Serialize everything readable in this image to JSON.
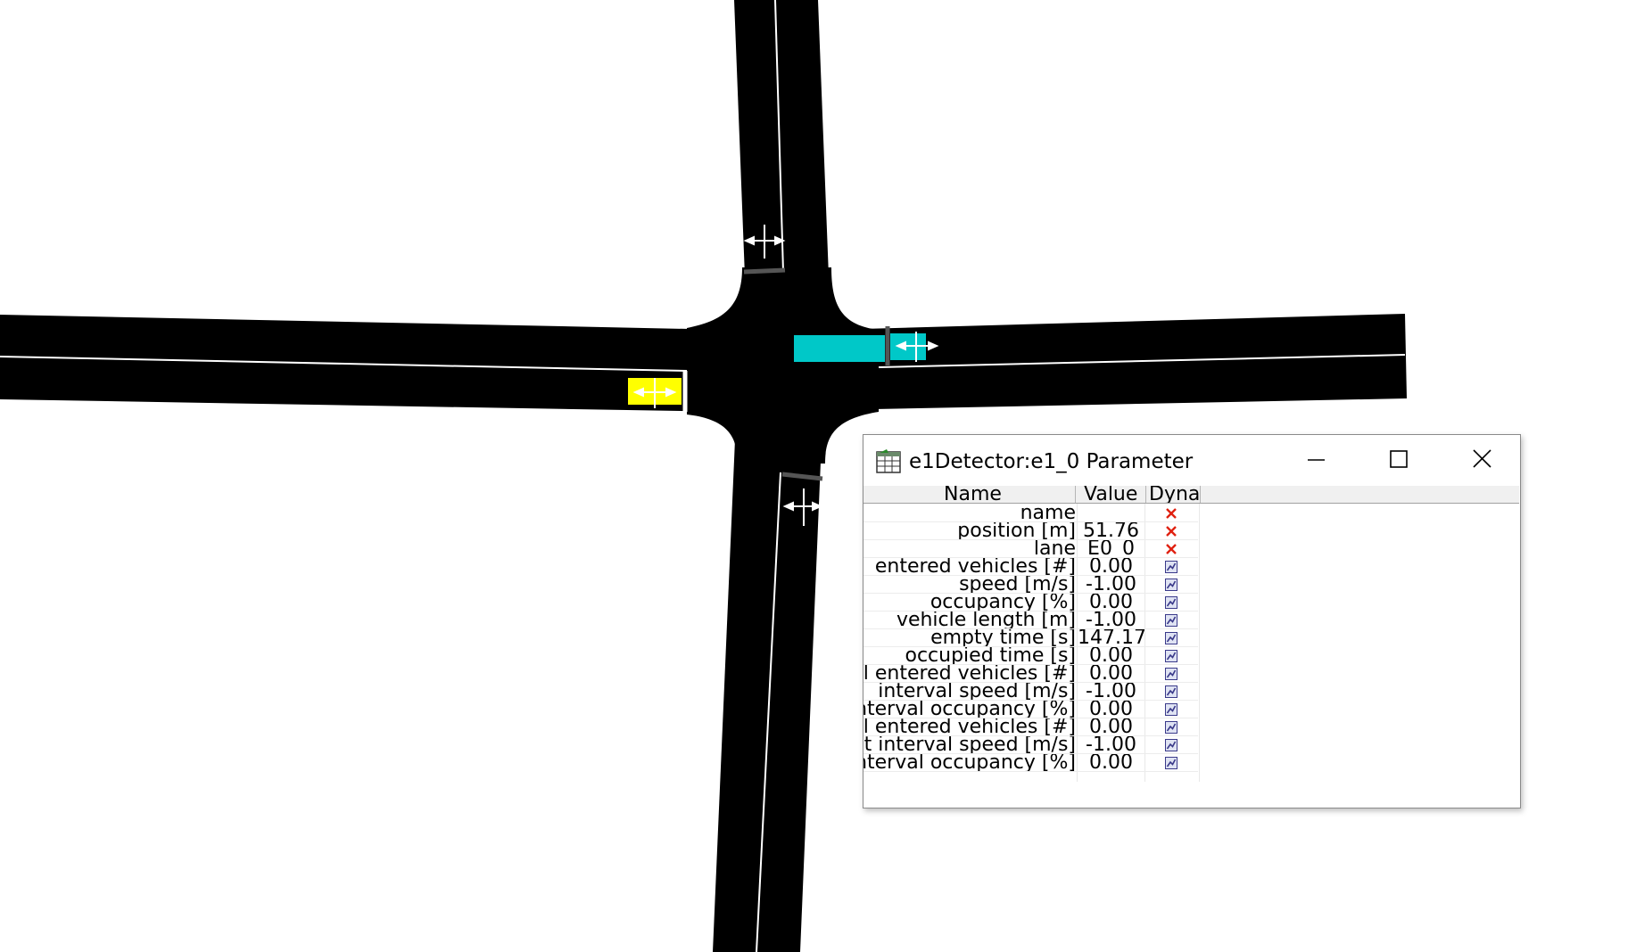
{
  "window": {
    "title": "e1Detector:e1_0 Parameter",
    "controls": {
      "minimize": "minimize",
      "maximize": "maximize",
      "close": "close"
    }
  },
  "table": {
    "columns": [
      "Name",
      "Value",
      "Dynam"
    ],
    "rows": [
      {
        "name": "name",
        "value": "",
        "dynamic": false
      },
      {
        "name": "position [m]",
        "value": "51.76",
        "dynamic": false
      },
      {
        "name": "lane",
        "value": "E0_0",
        "dynamic": false
      },
      {
        "name": "entered vehicles [#]",
        "value": "0.00",
        "dynamic": true
      },
      {
        "name": "speed [m/s]",
        "value": "-1.00",
        "dynamic": true
      },
      {
        "name": "occupancy [%]",
        "value": "0.00",
        "dynamic": true
      },
      {
        "name": "vehicle length [m]",
        "value": "-1.00",
        "dynamic": true
      },
      {
        "name": "empty time [s]",
        "value": "147.17",
        "dynamic": true
      },
      {
        "name": "occupied time [s]",
        "value": "0.00",
        "dynamic": true
      },
      {
        "name": "interval entered vehicles [#]",
        "value": "0.00",
        "dynamic": true
      },
      {
        "name": "interval speed [m/s]",
        "value": "-1.00",
        "dynamic": true
      },
      {
        "name": "interval occupancy [%]",
        "value": "0.00",
        "dynamic": true
      },
      {
        "name": "last interval entered vehicles [#]",
        "value": "0.00",
        "dynamic": true
      },
      {
        "name": "last interval speed [m/s]",
        "value": "-1.00",
        "dynamic": true
      },
      {
        "name": "last interval occupancy [%]",
        "value": "0.00",
        "dynamic": true
      }
    ]
  },
  "icons": {
    "static": "red-x-icon",
    "dynamic": "plot-icon",
    "app": "table-icon"
  },
  "colors": {
    "road": "#000000",
    "lane_marking": "#ffffff",
    "detector_cyan": "#00c8c8",
    "detector_yellow": "#ffff00",
    "static_x": "#e02010",
    "plot_icon": "#3a3a8a"
  }
}
